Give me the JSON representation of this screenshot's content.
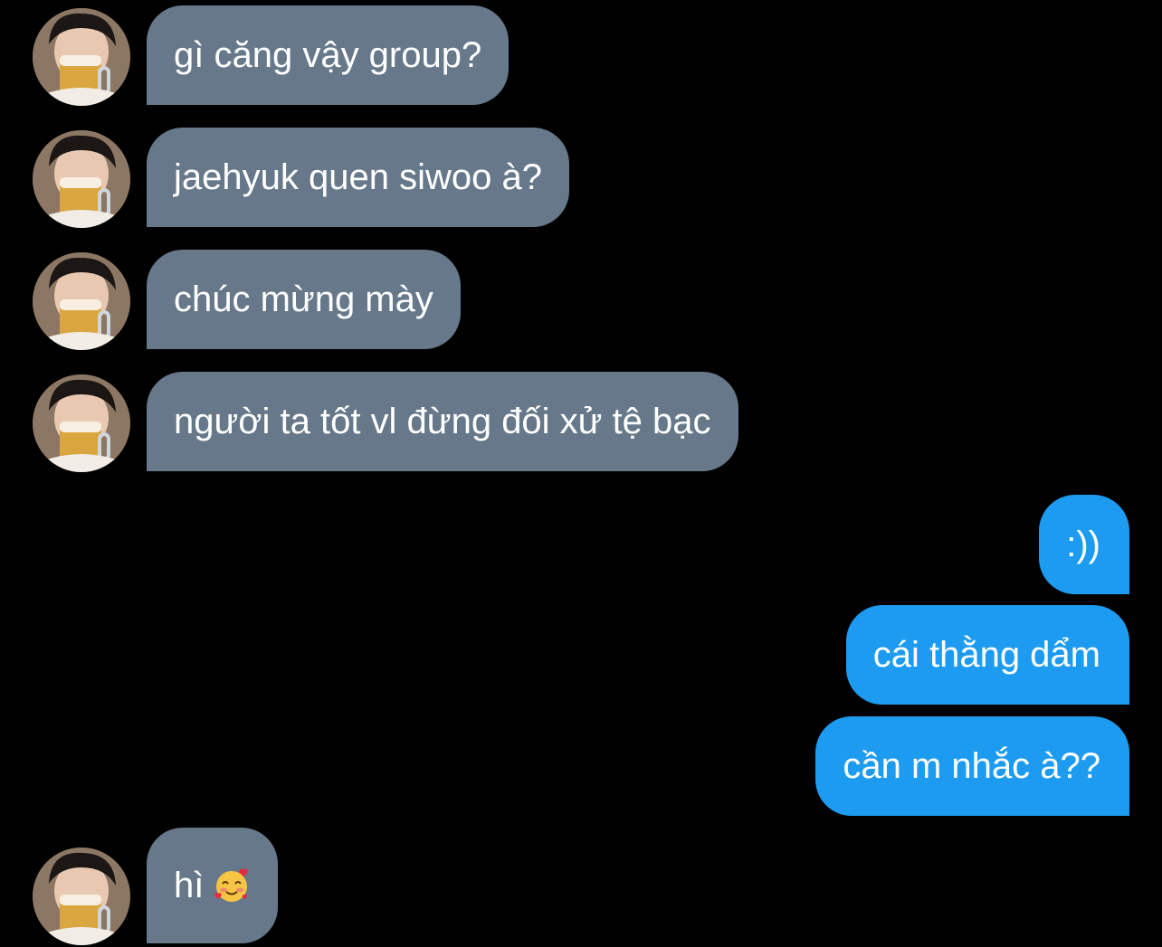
{
  "colors": {
    "background": "#000000",
    "incoming_bubble": "#66788a",
    "outgoing_bubble": "#1d9bf0",
    "text": "#ffffff"
  },
  "messages": [
    {
      "direction": "incoming",
      "text": "gì căng vậy group?",
      "avatar": "user-avatar"
    },
    {
      "direction": "incoming",
      "text": "jaehyuk quen siwoo à?",
      "avatar": "user-avatar"
    },
    {
      "direction": "incoming",
      "text": "chúc mừng mày",
      "avatar": "user-avatar"
    },
    {
      "direction": "incoming",
      "text": "người ta tốt vl đừng đối xử tệ bạc",
      "avatar": "user-avatar"
    },
    {
      "direction": "outgoing",
      "text": ":))"
    },
    {
      "direction": "outgoing",
      "text": "cái thằng dẩm"
    },
    {
      "direction": "outgoing",
      "text": "cần m nhắc à??"
    },
    {
      "direction": "incoming",
      "text": "hì",
      "emoji": "smiling-face-with-hearts-icon",
      "avatar": "user-avatar"
    }
  ]
}
